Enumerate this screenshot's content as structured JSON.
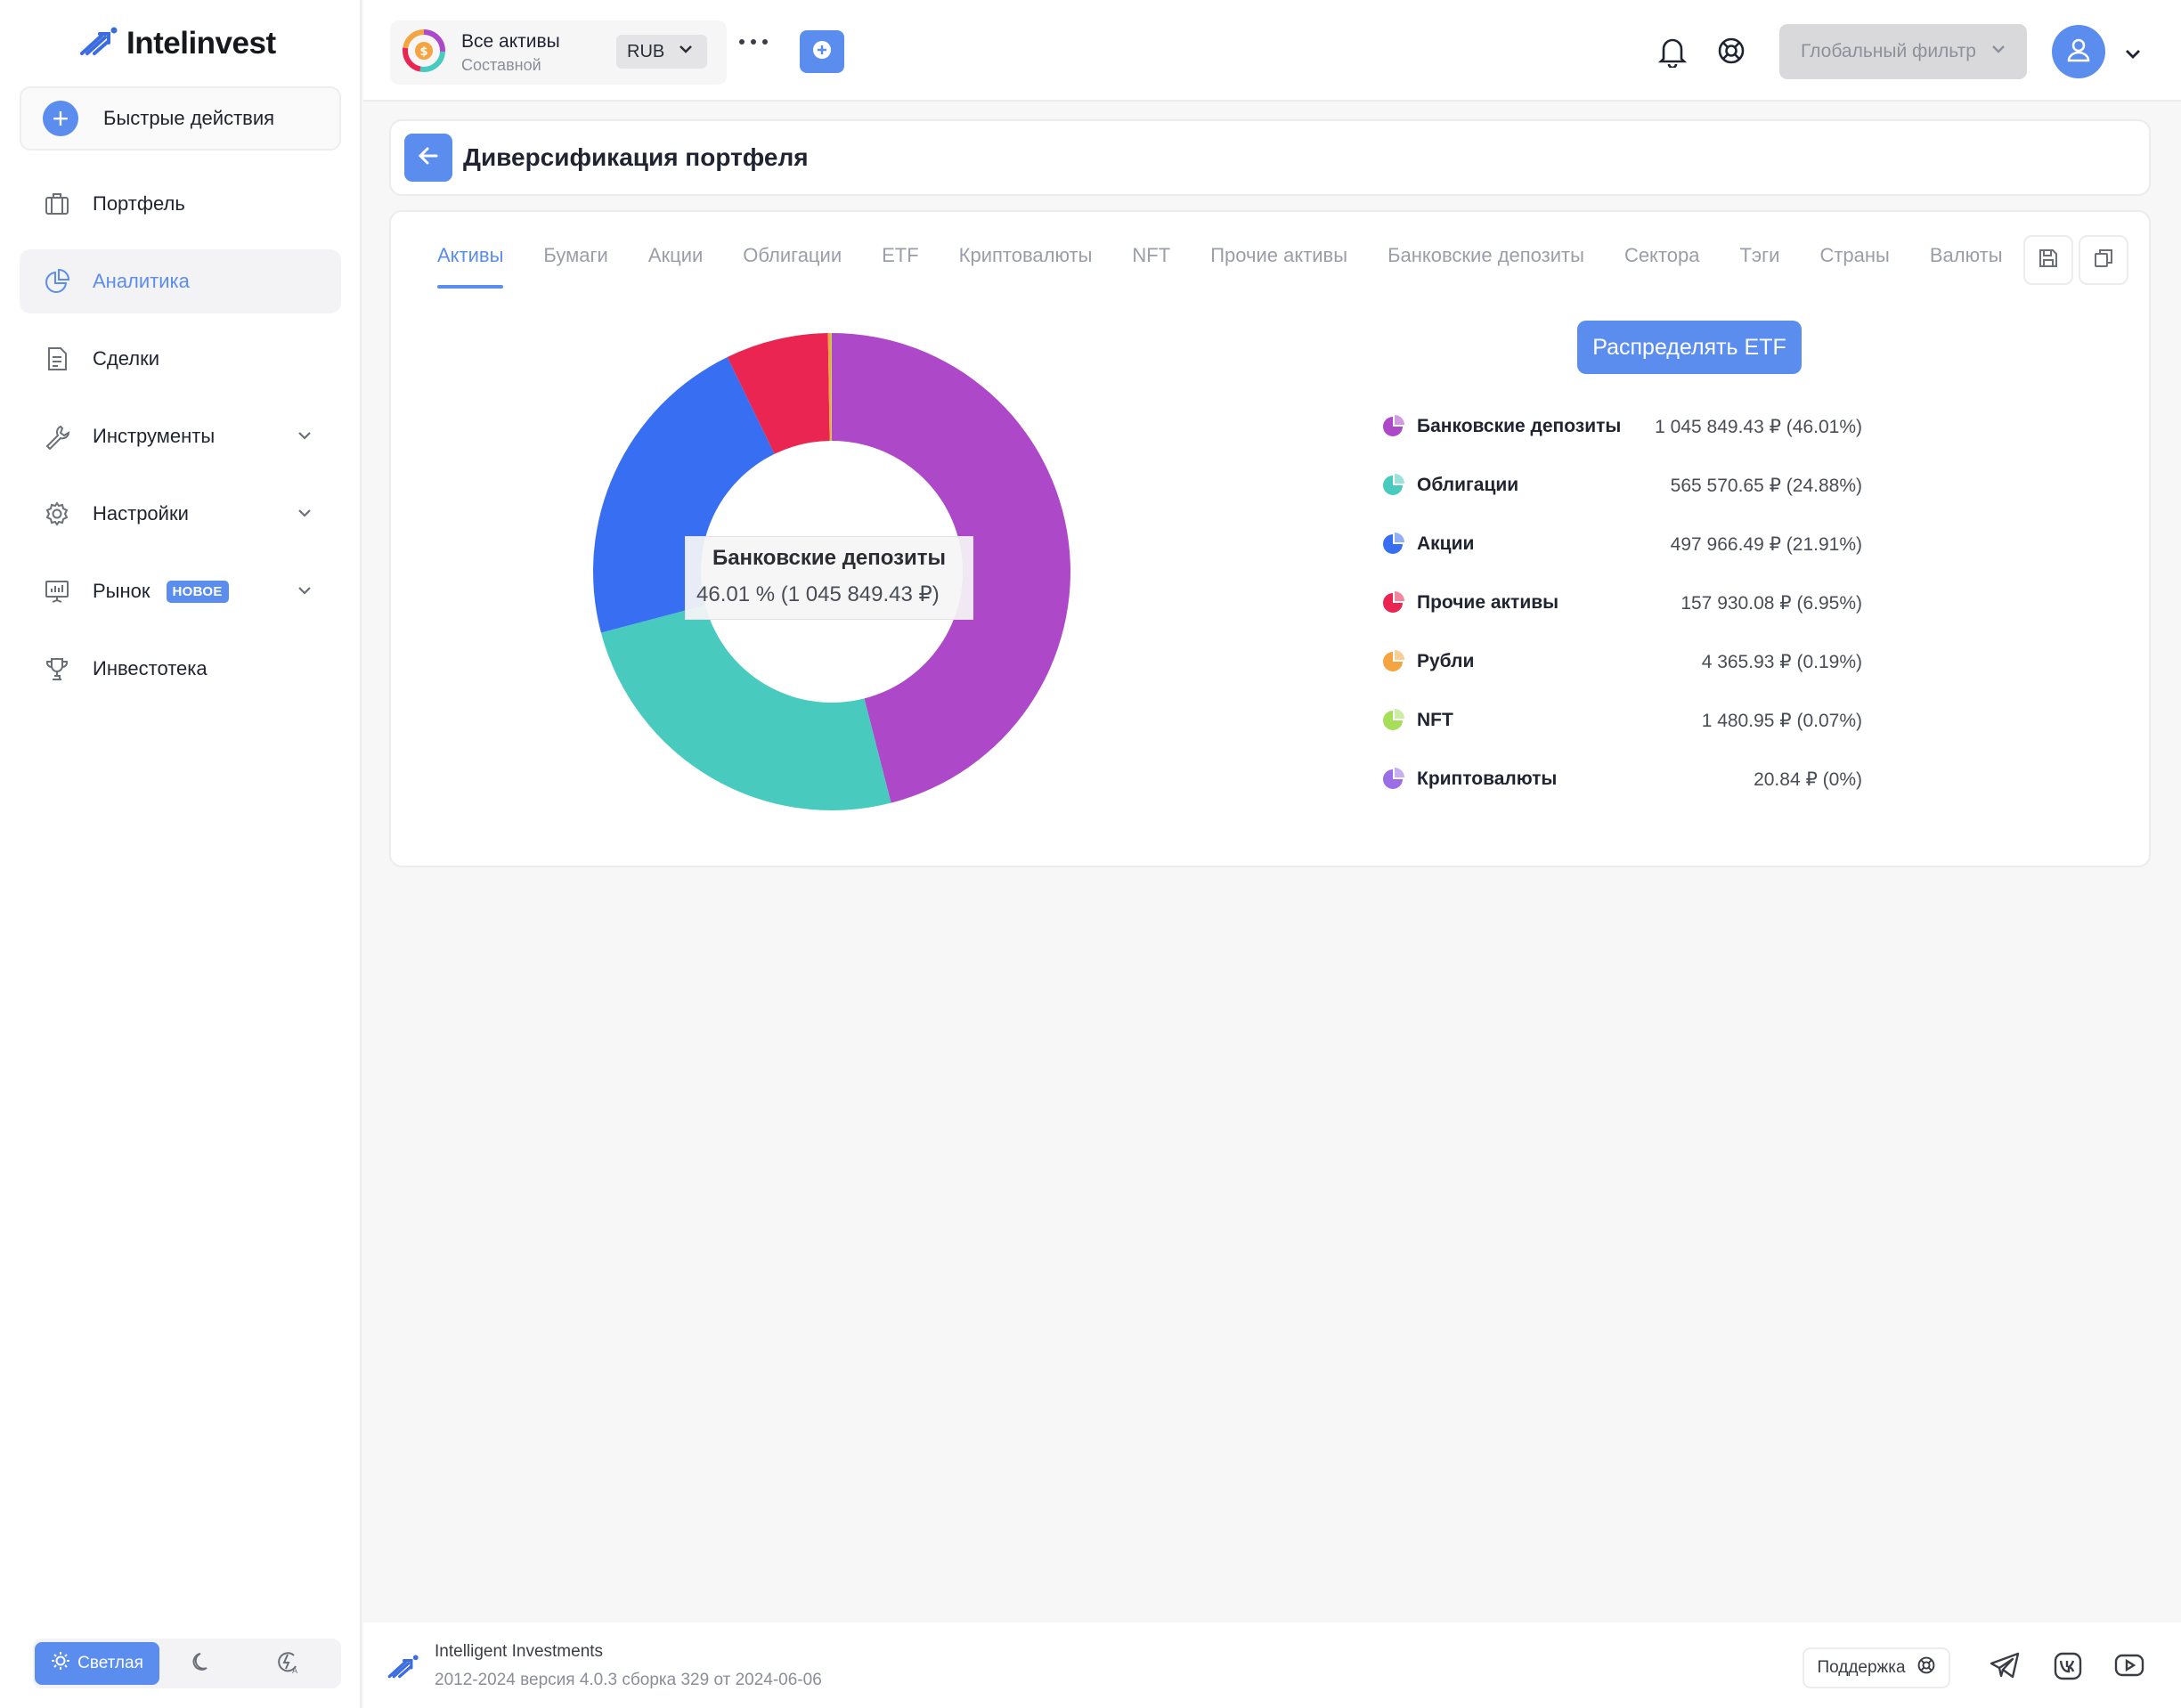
{
  "app": {
    "logo_text": "Intelinvest",
    "quick_actions": "Быстрые действия"
  },
  "sidebar": {
    "items": [
      {
        "label": "Портфель",
        "icon": "briefcase-icon"
      },
      {
        "label": "Аналитика",
        "icon": "pie-chart-icon",
        "active": true
      },
      {
        "label": "Сделки",
        "icon": "document-icon"
      },
      {
        "label": "Инструменты",
        "icon": "wrench-icon",
        "expandable": true
      },
      {
        "label": "Настройки",
        "icon": "gear-icon",
        "expandable": true
      },
      {
        "label": "Рынок",
        "icon": "presentation-icon",
        "expandable": true,
        "badge": "НОВОЕ"
      },
      {
        "label": "Инвестотека",
        "icon": "trophy-icon"
      }
    ],
    "theme": {
      "light_label": "Светлая",
      "active": "light"
    }
  },
  "header": {
    "portfolio_title": "Все активы",
    "portfolio_subtitle": "Составной",
    "currency": "RUB",
    "global_filter": "Глобальный фильтр"
  },
  "page": {
    "title": "Диверсификация портфеля"
  },
  "tabs": [
    {
      "label": "Активы",
      "active": true
    },
    {
      "label": "Бумаги"
    },
    {
      "label": "Акции"
    },
    {
      "label": "Облигации"
    },
    {
      "label": "ETF"
    },
    {
      "label": "Криптовалюты"
    },
    {
      "label": "NFT"
    },
    {
      "label": "Прочие активы"
    },
    {
      "label": "Банковские депозиты"
    },
    {
      "label": "Сектора"
    },
    {
      "label": "Тэги"
    },
    {
      "label": "Страны"
    },
    {
      "label": "Валюты"
    }
  ],
  "etf_button": "Распределять ETF",
  "tooltip": {
    "title": "Банковские депозиты",
    "value": "46.01 % (1 045 849.43 ₽)"
  },
  "legend": [
    {
      "name": "Банковские депозиты",
      "value": "1 045 849.43 ₽ (46.01%)",
      "color": "#ad48c8"
    },
    {
      "name": "Облигации",
      "value": "565 570.65 ₽ (24.88%)",
      "color": "#48cbbe"
    },
    {
      "name": "Акции",
      "value": "497 966.49 ₽ (21.91%)",
      "color": "#386ff2"
    },
    {
      "name": "Прочие активы",
      "value": "157 930.08 ₽ (6.95%)",
      "color": "#ea2551"
    },
    {
      "name": "Рубли",
      "value": "4 365.93 ₽ (0.19%)",
      "color": "#f4a440"
    },
    {
      "name": "NFT",
      "value": "1 480.95 ₽ (0.07%)",
      "color": "#a6de5a"
    },
    {
      "name": "Криптовалюты",
      "value": "20.84 ₽ (0%)",
      "color": "#9b6ee8"
    }
  ],
  "chart_data": {
    "type": "pie",
    "categories": [
      "Банковские депозиты",
      "Облигации",
      "Акции",
      "Прочие активы",
      "Рубли",
      "NFT",
      "Криптовалюты"
    ],
    "values": [
      1045849.43,
      565570.65,
      497966.49,
      157930.08,
      4365.93,
      1480.95,
      20.84
    ],
    "percent": [
      46.01,
      24.88,
      21.91,
      6.95,
      0.19,
      0.07,
      0.0
    ],
    "colors": [
      "#ad48c8",
      "#48cbbe",
      "#386ff2",
      "#ea2551",
      "#f4a440",
      "#a6de5a",
      "#9b6ee8"
    ],
    "donut": true,
    "unit": "₽"
  },
  "footer": {
    "company": "Intelligent Investments",
    "version": "2012-2024 версия 4.0.3 сборка 329 от 2024-06-06",
    "support": "Поддержка"
  }
}
